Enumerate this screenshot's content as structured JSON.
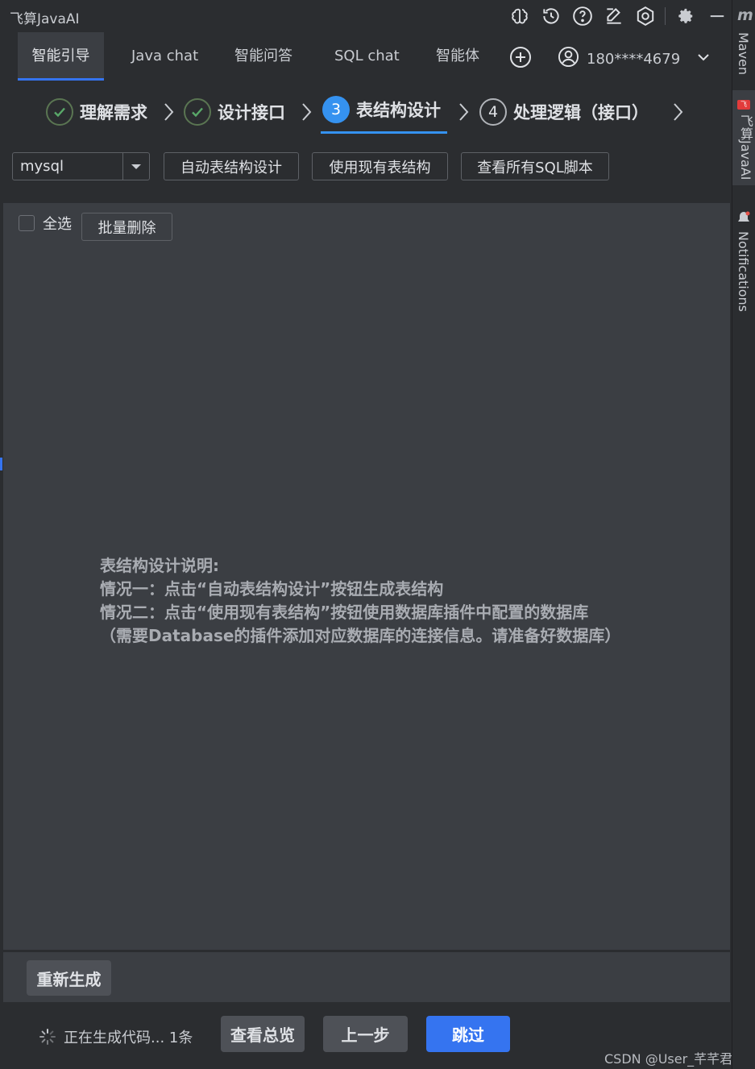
{
  "window": {
    "title": "飞算JavaAI"
  },
  "tabs": [
    {
      "label": "智能引导",
      "active": true
    },
    {
      "label": "Java chat",
      "active": false
    },
    {
      "label": "智能问答",
      "active": false
    },
    {
      "label": "SQL chat",
      "active": false
    },
    {
      "label": "智能体",
      "active": false
    }
  ],
  "user": {
    "phone": "180****4679"
  },
  "steps": [
    {
      "label": "理解需求",
      "state": "done"
    },
    {
      "label": "设计接口",
      "state": "done"
    },
    {
      "number": "3",
      "label": "表结构设计",
      "state": "current"
    },
    {
      "number": "4",
      "label": "处理逻辑（接口）",
      "state": "pending"
    }
  ],
  "toolbar": {
    "db_select_value": "mysql",
    "auto_design_label": "自动表结构设计",
    "use_existing_label": "使用现有表结构",
    "view_sql_label": "查看所有SQL脚本"
  },
  "content": {
    "select_all_label": "全选",
    "bulk_delete_label": "批量删除",
    "description": [
      "表结构设计说明:",
      "情况一：点击“自动表结构设计”按钮生成表结构",
      "情况二：点击“使用现有表结构”按钮使用数据库插件中配置的数据库",
      "（需要Database的插件添加对应数据库的连接信息。请准备好数据库）"
    ]
  },
  "regenerate_label": "重新生成",
  "bottom": {
    "status_text": "正在生成代码... 1条",
    "overview_label": "查看总览",
    "prev_label": "上一步",
    "skip_label": "跳过"
  },
  "side_panel": {
    "maven_label": "Maven",
    "feisuan_label": "飞算JavaAI",
    "notifications_label": "Notifications"
  },
  "watermark": "CSDN @User_芊芊君子",
  "colors": {
    "accent": "#3574f0",
    "step_active": "#3592f0",
    "check_green": "#59a869",
    "bg": "#2b2d30",
    "panel": "#3b3e43"
  }
}
